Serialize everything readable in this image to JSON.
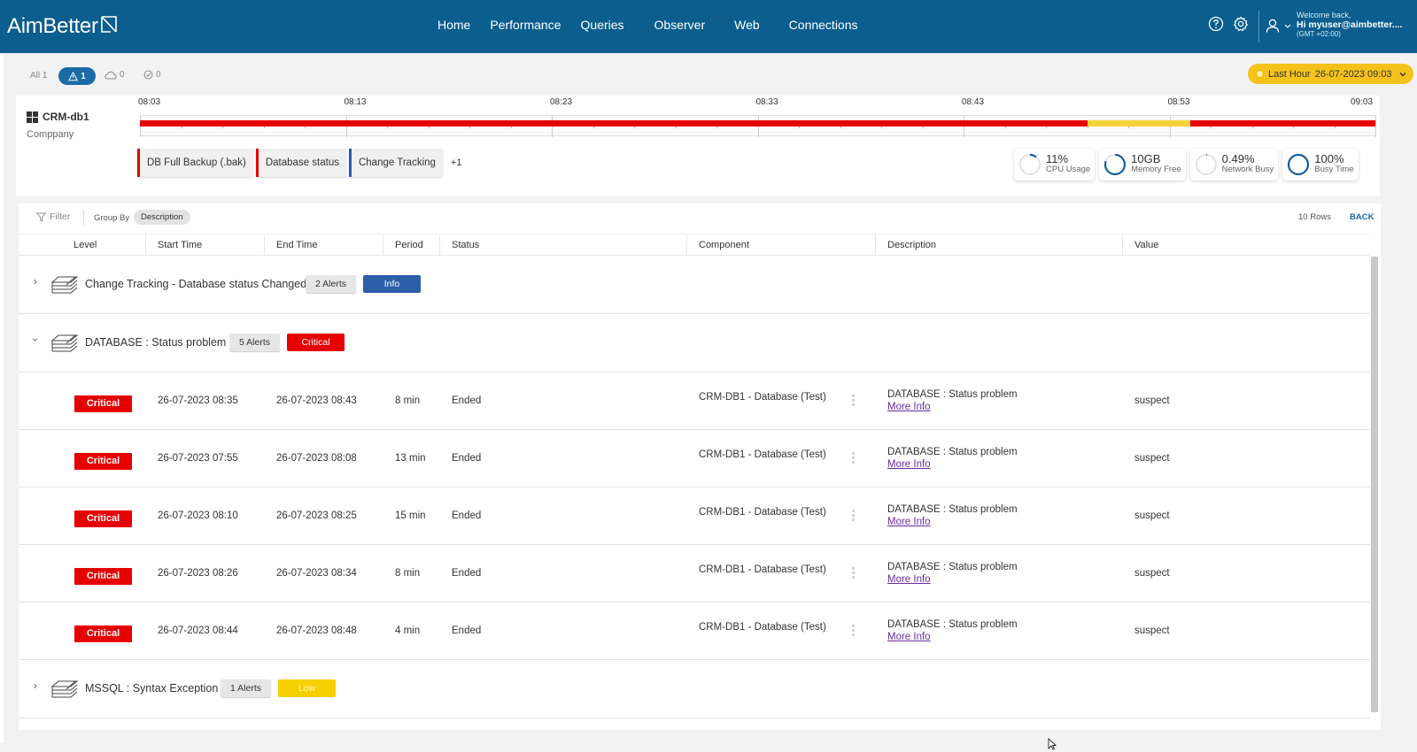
{
  "app": {
    "logo_text": "AimBetter",
    "nav": [
      {
        "label": "Home",
        "active": true
      },
      {
        "label": "Performance",
        "active": false
      },
      {
        "label": "Queries",
        "active": false
      },
      {
        "label": "Observer",
        "active": false
      },
      {
        "label": "Web",
        "active": false
      },
      {
        "label": "Connections",
        "active": false
      }
    ],
    "user": {
      "welcome": "Welcome back,",
      "name": "Hi myuser@aimbetter....",
      "timezone": "(GMT +02:00)"
    },
    "icons": [
      "help-icon",
      "settings-icon",
      "user-icon",
      "chevron-down-icon"
    ]
  },
  "filters": {
    "all_label": "All 1",
    "alert_count": "1",
    "cloud_count": "0",
    "check_count": "0",
    "time_range": {
      "label": "Last Hour",
      "value": "26-07-2023 09:03"
    }
  },
  "server": {
    "name": "CRM-db1",
    "company": "Comppany",
    "timeline_ticks": [
      "08:03",
      "08:13",
      "08:23",
      "08:33",
      "08:43",
      "08:53",
      "09:03"
    ],
    "timeline_segments": [
      {
        "from": "08:03",
        "to": "08:49",
        "color": "#e60000"
      },
      {
        "from": "08:49",
        "to": "08:54",
        "color": "#f6d23a"
      },
      {
        "from": "08:54",
        "to": "09:03",
        "color": "#e60000"
      }
    ],
    "chips": [
      {
        "label": "DB Full Backup (.bak)",
        "color": "#e60000"
      },
      {
        "label": "Database status",
        "color": "#e60000"
      },
      {
        "label": "Change Tracking",
        "color": "#2c5ea8"
      }
    ],
    "chips_more": "+1",
    "metrics": [
      {
        "value": "11%",
        "label": "CPU Usage",
        "fraction": 0.11
      },
      {
        "value": "10GB",
        "label": "Memory Free",
        "fraction": 0.8
      },
      {
        "value": "0.49%",
        "label": "Network Busy",
        "fraction": 0.005
      },
      {
        "value": "100%",
        "label": "Busy Time",
        "fraction": 1.0
      }
    ]
  },
  "grid": {
    "filter_label": "Filter",
    "group_by_label": "Group By",
    "group_by_value": "Description",
    "rows_label": "10 Rows",
    "back_label": "BACK",
    "columns": [
      "Level",
      "Start Time",
      "End Time",
      "Period",
      "Status",
      "Component",
      "Description",
      "Value"
    ],
    "groups": [
      {
        "title": "Change Tracking - Database status Changed",
        "alerts": "2 Alerts",
        "severity": "Info",
        "expanded": false
      },
      {
        "title": "DATABASE : Status problem",
        "alerts": "5 Alerts",
        "severity": "Critical",
        "expanded": true
      },
      {
        "title": "MSSQL : Syntax Exception",
        "alerts": "1 Alerts",
        "severity": "Low",
        "expanded": false
      }
    ],
    "rows": [
      {
        "level": "Critical",
        "start": "26-07-2023 08:35",
        "end": "26-07-2023 08:43",
        "period": "8 min",
        "status": "Ended",
        "component": "CRM-DB1 - Database (Test)",
        "description": "DATABASE : Status problem",
        "more": "More Info",
        "value": "suspect"
      },
      {
        "level": "Critical",
        "start": "26-07-2023 07:55",
        "end": "26-07-2023 08:08",
        "period": "13 min",
        "status": "Ended",
        "component": "CRM-DB1 - Database (Test)",
        "description": "DATABASE : Status problem",
        "more": "More Info",
        "value": "suspect"
      },
      {
        "level": "Critical",
        "start": "26-07-2023 08:10",
        "end": "26-07-2023 08:25",
        "period": "15 min",
        "status": "Ended",
        "component": "CRM-DB1 - Database (Test)",
        "description": "DATABASE : Status problem",
        "more": "More Info",
        "value": "suspect"
      },
      {
        "level": "Critical",
        "start": "26-07-2023 08:26",
        "end": "26-07-2023 08:34",
        "period": "8 min",
        "status": "Ended",
        "component": "CRM-DB1 - Database (Test)",
        "description": "DATABASE : Status problem",
        "more": "More Info",
        "value": "suspect"
      },
      {
        "level": "Critical",
        "start": "26-07-2023 08:44",
        "end": "26-07-2023 08:48",
        "period": "4 min",
        "status": "Ended",
        "component": "CRM-DB1 - Database (Test)",
        "description": "DATABASE : Status problem",
        "more": "More Info",
        "value": "suspect"
      }
    ]
  }
}
